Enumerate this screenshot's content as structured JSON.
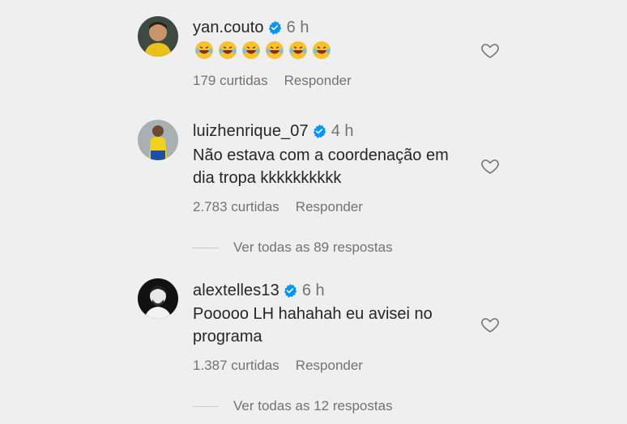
{
  "comments": [
    {
      "username": "yan.couto",
      "time": "6 h",
      "text": "",
      "emojis": [
        "laughing-emoji",
        "laughing-emoji",
        "laughing-emoji",
        "laughing-emoji",
        "laughing-emoji",
        "laughing-emoji"
      ],
      "likes": "179 curtidas",
      "reply_label": "Responder"
    },
    {
      "username": "luizhenrique_07",
      "time": "4 h",
      "text_line1": "Não estava com a coordenação em",
      "text_line2": "dia tropa kkkkkkkkkk",
      "likes": "2.783 curtidas",
      "reply_label": "Responder",
      "view_replies": "Ver todas as 89 respostas"
    },
    {
      "username": "alextelles13",
      "time": "6 h",
      "text_line1": "Pooooo LH hahahah eu avisei no",
      "text_line2": "programa",
      "likes": "1.387 curtidas",
      "reply_label": "Responder",
      "view_replies": "Ver todas as 12 respostas"
    }
  ],
  "colors": {
    "background": "#efefef",
    "text": "#262626",
    "secondary": "#737373",
    "verified": "#0095f6"
  }
}
